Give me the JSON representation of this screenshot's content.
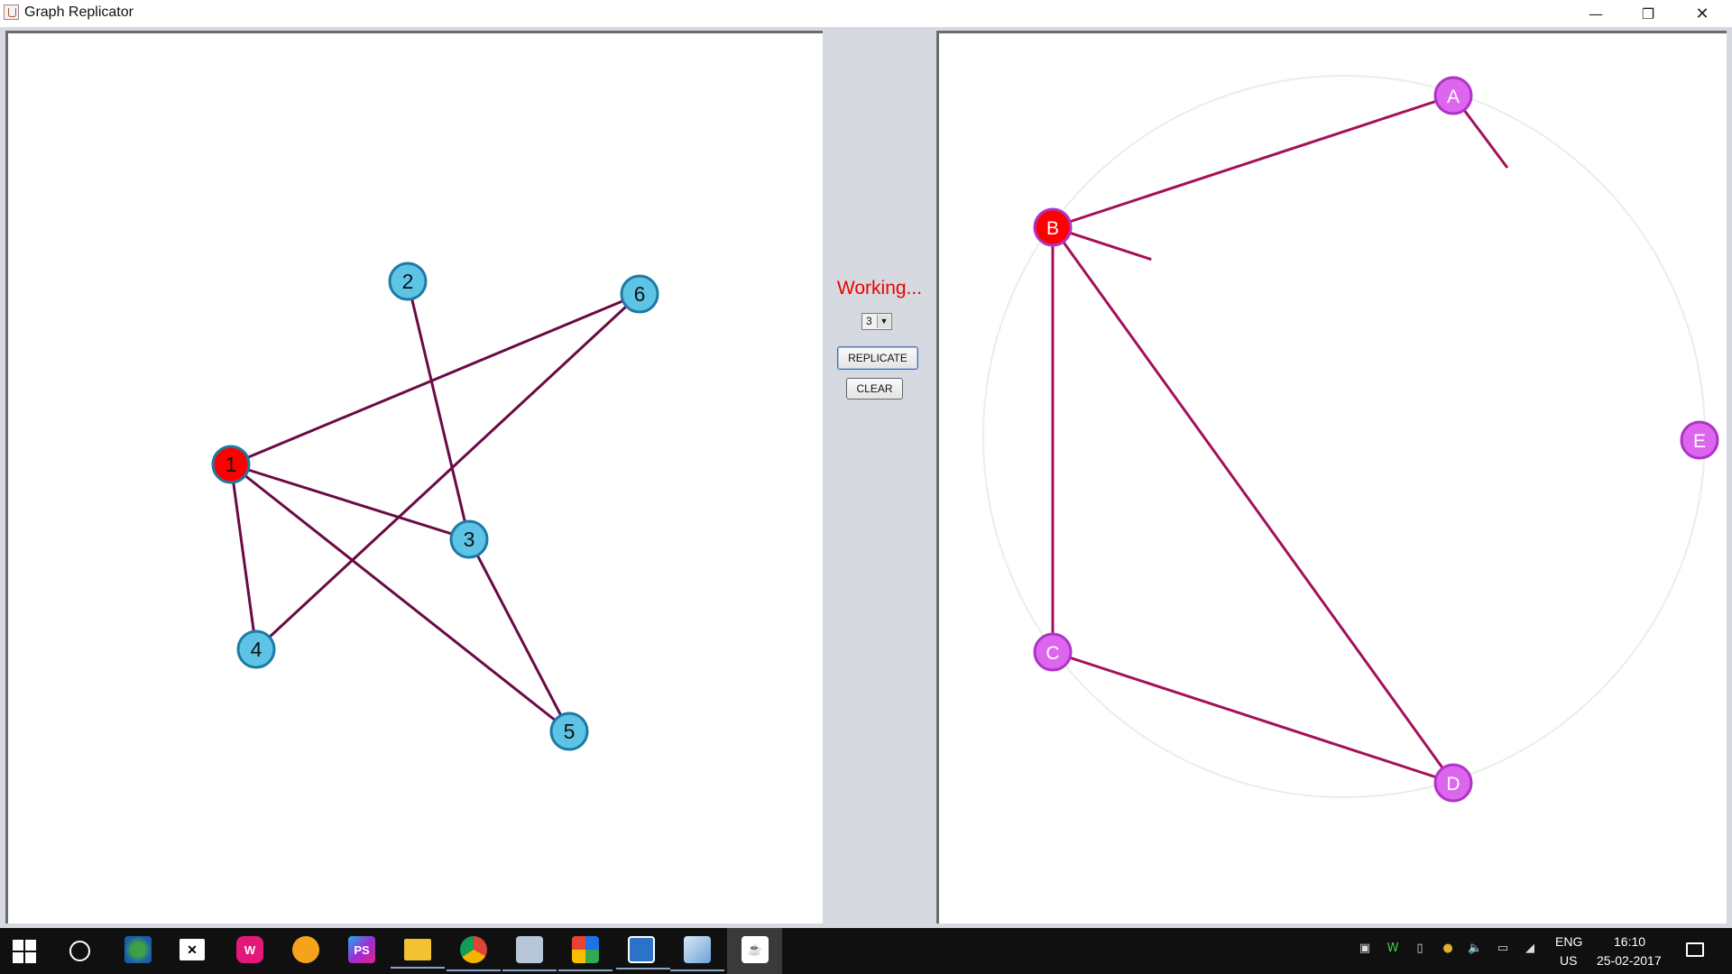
{
  "window": {
    "title": "Graph Replicator",
    "minimize_icon": "minimize-icon",
    "restore_icon": "restore-icon",
    "close_icon": "close-icon"
  },
  "controls": {
    "status": "Working...",
    "depth_value": "3",
    "replicate_label": "REPLICATE",
    "clear_label": "CLEAR",
    "status_color": "#ee0000"
  },
  "left_graph": {
    "node_fill": "#5ec4e6",
    "node_stroke": "#1c7aa5",
    "selected_fill": "#ff0000",
    "edge_color": "#6a0a45",
    "nodes": [
      {
        "id": "1",
        "selected": true
      },
      {
        "id": "2",
        "selected": false
      },
      {
        "id": "3",
        "selected": false
      },
      {
        "id": "4",
        "selected": false
      },
      {
        "id": "5",
        "selected": false
      },
      {
        "id": "6",
        "selected": false
      }
    ],
    "edges": [
      [
        "1",
        "6"
      ],
      [
        "1",
        "3"
      ],
      [
        "1",
        "4"
      ],
      [
        "1",
        "5"
      ],
      [
        "2",
        "3"
      ],
      [
        "3",
        "5"
      ],
      [
        "4",
        "6"
      ]
    ]
  },
  "right_graph": {
    "node_fill": "#dd66ee",
    "node_stroke": "#b033c6",
    "selected_fill": "#ff0000",
    "edge_color": "#a3105a",
    "guide_circle_color": "#e4f2e4",
    "nodes": [
      {
        "id": "A",
        "selected": false
      },
      {
        "id": "B",
        "selected": true
      },
      {
        "id": "C",
        "selected": false
      },
      {
        "id": "D",
        "selected": false
      },
      {
        "id": "E",
        "selected": false
      }
    ],
    "edges": [
      [
        "A",
        "B"
      ],
      [
        "B",
        "C"
      ],
      [
        "B",
        "D"
      ],
      [
        "C",
        "D"
      ]
    ],
    "partial_edges": [
      {
        "from": "A",
        "toward": "E"
      },
      {
        "from": "B",
        "toward": "E"
      }
    ]
  },
  "taskbar": {
    "apps": [
      {
        "name": "start-icon"
      },
      {
        "name": "cortana-icon"
      },
      {
        "name": "network-globe-app-icon"
      },
      {
        "name": "xampp-icon"
      },
      {
        "name": "wamp-icon"
      },
      {
        "name": "circle-app-icon"
      },
      {
        "name": "phpstorm-icon",
        "label": "PS"
      },
      {
        "name": "file-explorer-icon"
      },
      {
        "name": "chrome-icon"
      },
      {
        "name": "photos-icon"
      },
      {
        "name": "windows-store-icon"
      },
      {
        "name": "screen-app-icon"
      },
      {
        "name": "virtualbox-icon"
      },
      {
        "name": "java-icon"
      }
    ],
    "language_top": "ENG",
    "language_bottom": "US",
    "time": "16:10",
    "date": "25-02-2017"
  }
}
